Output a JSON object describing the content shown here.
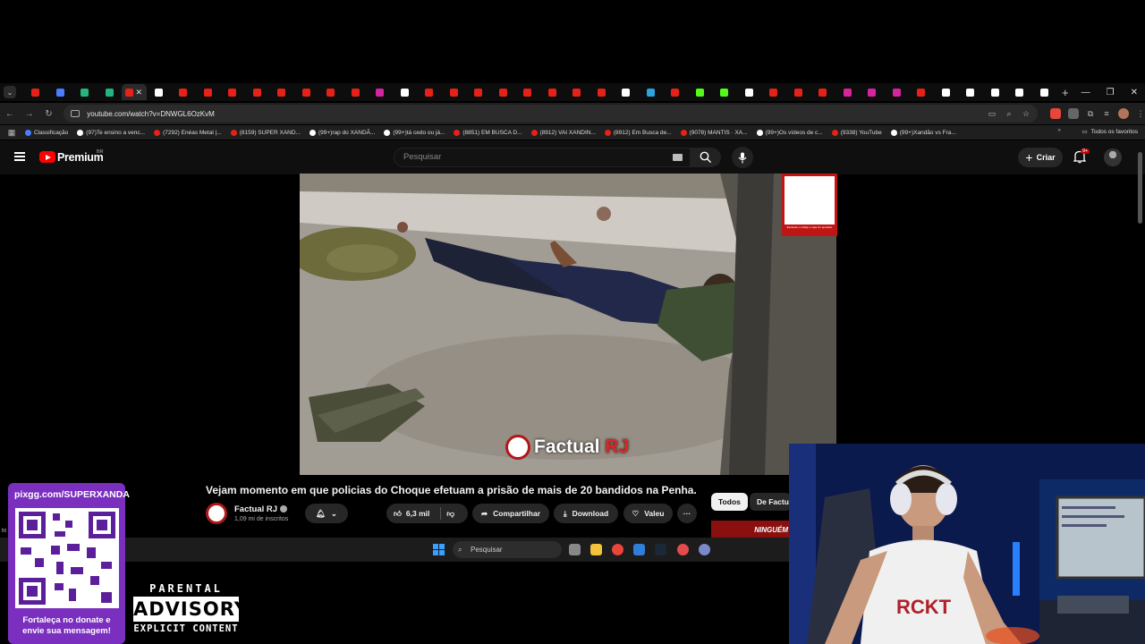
{
  "browser": {
    "tabs": [
      {
        "icon": "youtube-icon",
        "color": "#e62117"
      },
      {
        "icon": "meet-icon",
        "color": "#4a7cff"
      },
      {
        "icon": "code-icon",
        "color": "#24b47e"
      },
      {
        "icon": "code-icon",
        "color": "#24b47e"
      },
      {
        "icon": "youtube-icon",
        "color": "#e62117",
        "active": true
      },
      {
        "icon": "tiktok-icon",
        "color": "#ffffff"
      },
      {
        "icon": "youtube-icon",
        "color": "#e62117"
      },
      {
        "icon": "youtube-icon",
        "color": "#e62117"
      },
      {
        "icon": "youtube-icon",
        "color": "#e62117"
      },
      {
        "icon": "youtube-icon",
        "color": "#e62117"
      },
      {
        "icon": "youtube-icon",
        "color": "#e62117"
      },
      {
        "icon": "youtube-icon",
        "color": "#e62117"
      },
      {
        "icon": "youtube-icon",
        "color": "#e62117"
      },
      {
        "icon": "youtube-icon",
        "color": "#e62117"
      },
      {
        "icon": "instagram-icon",
        "color": "#d6249f"
      },
      {
        "icon": "tiktok-icon",
        "color": "#ffffff"
      },
      {
        "icon": "youtube-icon",
        "color": "#e62117"
      },
      {
        "icon": "youtube-icon",
        "color": "#e62117"
      },
      {
        "icon": "youtube-icon",
        "color": "#e62117"
      },
      {
        "icon": "youtube-icon",
        "color": "#e62117"
      },
      {
        "icon": "youtube-icon",
        "color": "#e62117"
      },
      {
        "icon": "youtube-icon",
        "color": "#e62117"
      },
      {
        "icon": "youtube-icon",
        "color": "#e62117"
      },
      {
        "icon": "youtube-icon",
        "color": "#e62117"
      },
      {
        "icon": "tiktok-icon",
        "color": "#ffffff"
      },
      {
        "icon": "telegram-icon",
        "color": "#2aa3df"
      },
      {
        "icon": "youtube-icon",
        "color": "#e62117"
      },
      {
        "icon": "kick-icon",
        "color": "#53fc18"
      },
      {
        "icon": "kick-icon",
        "color": "#53fc18"
      },
      {
        "icon": "google-icon",
        "color": "#ffffff"
      },
      {
        "icon": "youtube-icon",
        "color": "#e62117"
      },
      {
        "icon": "youtube-icon",
        "color": "#e62117"
      },
      {
        "icon": "youtube-icon",
        "color": "#e62117"
      },
      {
        "icon": "instagram-icon",
        "color": "#d6249f"
      },
      {
        "icon": "instagram-icon",
        "color": "#d6249f"
      },
      {
        "icon": "instagram-icon",
        "color": "#d6249f"
      },
      {
        "icon": "youtube-icon",
        "color": "#e62117"
      },
      {
        "icon": "tiktok-icon",
        "color": "#ffffff"
      },
      {
        "icon": "tiktok-icon",
        "color": "#ffffff"
      },
      {
        "icon": "tiktok-icon",
        "color": "#ffffff"
      },
      {
        "icon": "tiktok-icon",
        "color": "#ffffff"
      },
      {
        "icon": "tiktok-icon",
        "color": "#ffffff"
      }
    ],
    "url": "youtube.com/watch?v=DNWGL6OzKvM",
    "bookmarks": [
      {
        "label": "Classificação",
        "color": "#4a7cff"
      },
      {
        "label": "(97)Te ensino a venc...",
        "color": "#ffffff"
      },
      {
        "label": "(7292) Enéas Metal |...",
        "color": "#e62117"
      },
      {
        "label": "(8159) SUPER XAND...",
        "color": "#e62117"
      },
      {
        "label": "(99+)rap do XANDÃ...",
        "color": "#ffffff"
      },
      {
        "label": "(99+)tá cedo ou já...",
        "color": "#ffffff"
      },
      {
        "label": "(8851) EM BUSCA D...",
        "color": "#e62117"
      },
      {
        "label": "(8912) VAI XANDIN...",
        "color": "#e62117"
      },
      {
        "label": "(8912) Em Busca de...",
        "color": "#e62117"
      },
      {
        "label": "(9078) MANTIS · XA...",
        "color": "#e62117"
      },
      {
        "label": "(99+)Os vídeos de c...",
        "color": "#ffffff"
      },
      {
        "label": "(9338) YouTube",
        "color": "#e62117"
      },
      {
        "label": "(99+)Xandão vs Fra...",
        "color": "#ffffff"
      }
    ],
    "all_bookmarks": "Todos os favoritos"
  },
  "youtube": {
    "brand": "Premium",
    "country": "BR",
    "search_placeholder": "Pesquisar",
    "create_label": "Criar",
    "notif_count": "9+",
    "video": {
      "title": "Vejam momento em que policias do Choque efetuam a prisão de mais de 20 bandidos na Penha.",
      "watermark_a": "Factual",
      "watermark_b": "RJ",
      "qr_caption": "Escaneie o código e seja um apoiador"
    },
    "channel": {
      "name": "Factual RJ",
      "subs": "1,09 mi de inscritos"
    },
    "actions": {
      "likes": "6,3 mil",
      "share": "Compartilhar",
      "download": "Download",
      "thanks": "Valeu"
    },
    "chips": [
      "Todos",
      "De Factua"
    ],
    "next_thumb_text": "NINGUÉM"
  },
  "taskbar": {
    "search_placeholder": "Pesquisar",
    "status_url": "ht"
  },
  "overlay": {
    "donate_url": "pixgg.com/SUPERXANDA",
    "donate_msg_1": "Fortaleça no donate e",
    "donate_msg_2": "envie sua mensagem!",
    "pa_top": "PARENTAL",
    "pa_mid": "ADVISORY",
    "pa_bot": "EXPLICIT CONTENT"
  }
}
